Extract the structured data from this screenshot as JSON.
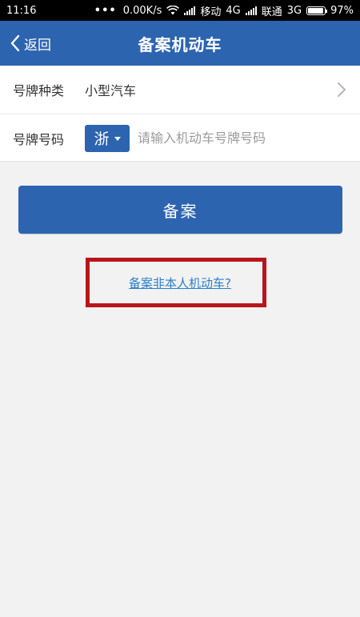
{
  "status_bar": {
    "time": "11:16",
    "speed": "0.00K/s",
    "carrier1": "移动",
    "net1": "4G",
    "carrier2": "联通",
    "net2": "3G",
    "battery": "97%",
    "battery_level": 0.97
  },
  "navbar": {
    "back_label": "返回",
    "title": "备案机动车"
  },
  "form": {
    "plate_type_label": "号牌种类",
    "plate_type_value": "小型汽车",
    "plate_number_label": "号牌号码",
    "province": "浙",
    "plate_placeholder": "请输入机动车号牌号码",
    "plate_value": ""
  },
  "actions": {
    "submit_label": "备案",
    "other_vehicle_link": "备案非本人机动车?"
  },
  "colors": {
    "brand": "#2d64b0",
    "link": "#2d80c5",
    "highlight": "#b8161b"
  }
}
